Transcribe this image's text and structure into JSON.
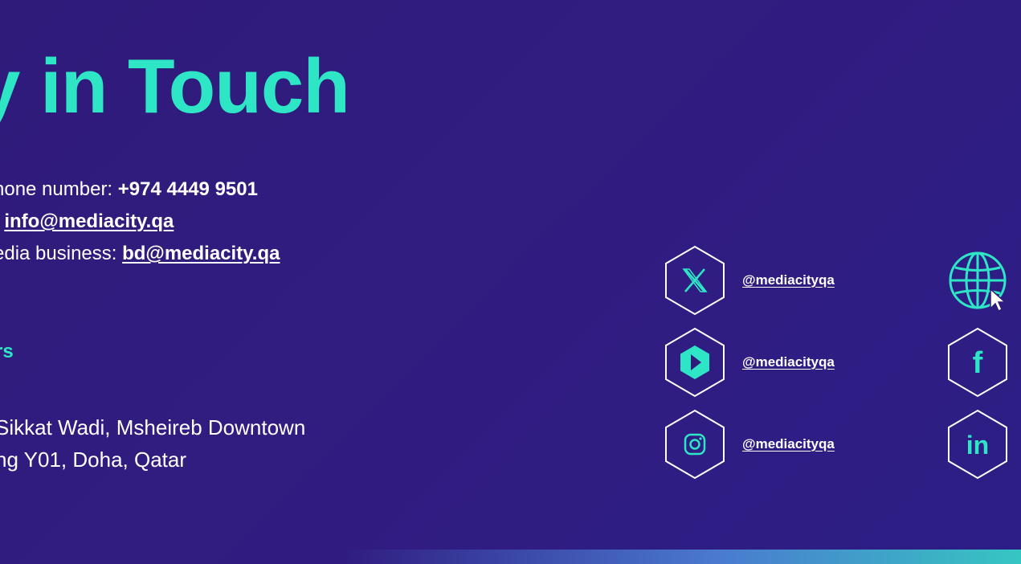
{
  "heading": "y in Touch",
  "contact": {
    "phone_label": "hone number: ",
    "phone_value": "+974 4449 9501",
    "email_label": ": ",
    "email_value": "info@mediacity.qa",
    "business_label": "edia business: ",
    "business_value": "bd@mediacity.qa"
  },
  "section_heading": "rs",
  "address": {
    "line1": "Sikkat Wadi, Msheireb Downtown",
    "line2": "ng Y01, Doha, Qatar"
  },
  "social": [
    {
      "icon": "x-logo-icon",
      "handle": "@mediacityqa"
    },
    {
      "icon": "play-logo-icon",
      "handle": "@mediacityqa"
    },
    {
      "icon": "instagram-icon",
      "handle": "@mediacityqa"
    }
  ],
  "right_icons": [
    "globe-icon",
    "facebook-icon",
    "linkedin-icon"
  ],
  "right_icon_text": {
    "facebook": "f",
    "linkedin": "in"
  },
  "colors": {
    "accent": "#2ee6c6",
    "background": "#2f1b7a",
    "text": "#ffffff"
  }
}
